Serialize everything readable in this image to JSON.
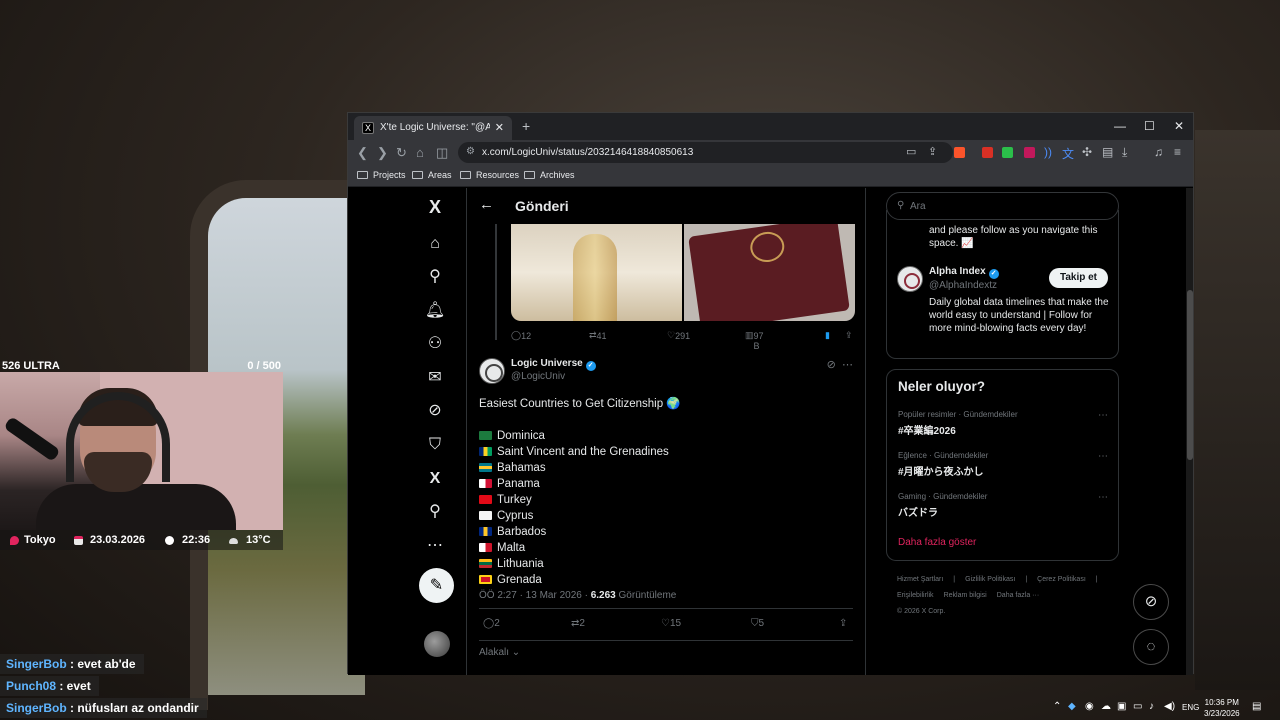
{
  "overlay": {
    "stream_title": "526 ULTRA",
    "counter": "0  / 500",
    "location": "Tokyo",
    "date": "23.03.2026",
    "time": "22:36",
    "weather": "13°C"
  },
  "chat": [
    {
      "nick": "SingerBob",
      "text": " : evet ab'de"
    },
    {
      "nick": "Punch08",
      "text": " : evet"
    },
    {
      "nick": "SingerBob",
      "text": " : nüfusları az ondandir"
    }
  ],
  "browser": {
    "tab_title": "X'te Logic Universe: \"@AlphaInd",
    "url": "x.com/LogicUniv/status/2032146418840850613",
    "bookmarks": [
      "Projects",
      "Areas",
      "Resources",
      "Archives"
    ]
  },
  "x_page": {
    "header_title": "Gönderi",
    "prev_tweet_actions": {
      "replies": "12",
      "reposts": "41",
      "likes": "291",
      "views": "97 B"
    },
    "tweet": {
      "author": "Logic Universe",
      "handle": "@LogicUniv",
      "headline": "Easiest Countries to Get Citizenship 🌍",
      "countries": [
        {
          "name": "Dominica",
          "flag_color": "#1c7a3e"
        },
        {
          "name": "Saint Vincent and the Grenadines",
          "flag_color": "#e7c51a"
        },
        {
          "name": "Bahamas",
          "flag_color": "#12b5cb"
        },
        {
          "name": "Panama",
          "flag_color": "#d21034"
        },
        {
          "name": "Turkey",
          "flag_color": "#e30a17"
        },
        {
          "name": "Cyprus",
          "flag_color": "#f5f5f5"
        },
        {
          "name": "Barbados",
          "flag_color": "#f9c300"
        },
        {
          "name": "Malta",
          "flag_color": "#cf142b"
        },
        {
          "name": "Lithuania",
          "flag_color": "#006a44"
        },
        {
          "name": "Grenada",
          "flag_color": "#ce1126"
        }
      ],
      "timestamp": "ÖÖ 2:27 · 13 Mar 2026 · ",
      "views_count": "6.263",
      "views_label": " Görüntüleme",
      "replies": "2",
      "reposts": "2",
      "likes": "15",
      "bookmarks": "5"
    },
    "related_label": "Alakalı",
    "search_placeholder": "Ara",
    "prev_profile_tail": "and please follow as you navigate this space. 📈",
    "suggest": {
      "name": "Alpha Index",
      "handle": "@AlphaIndextz",
      "follow_label": "Takip et",
      "bio": "Daily global data timelines that make the world easy to understand | Follow for more mind-blowing facts every day!"
    },
    "trends_title": "Neler oluyor?",
    "trends": [
      {
        "category": "Popüler resimler · Gündemdekiler",
        "name": "#卒業編2026"
      },
      {
        "category": "Eğlence · Gündemdekiler",
        "name": "#月曜から夜ふかし"
      },
      {
        "category": "Gaming · Gündemdekiler",
        "name": "バズドラ"
      }
    ],
    "show_more": "Daha fazla göster",
    "footer_links": [
      "Hizmet Şartları",
      "|",
      "Gizlilik Politikası",
      "|",
      "Çerez Politikası",
      "|",
      "Erişilebilirlik",
      "Reklam bilgisi",
      "Daha fazla ···",
      "© 2026 X Corp."
    ]
  },
  "taskbar": {
    "lang": "ENG",
    "time": "10:36 PM",
    "date": "3/23/2026"
  },
  "colors": {
    "accent": "#1d9bf0",
    "show_more": "#e0245e"
  }
}
